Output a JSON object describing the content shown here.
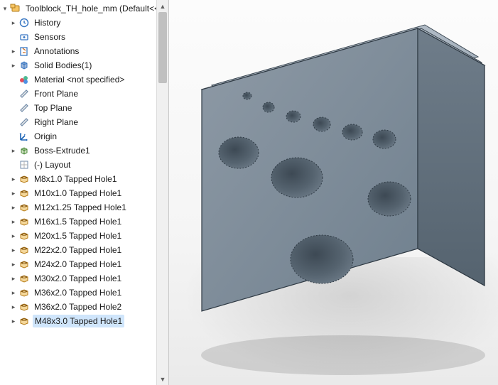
{
  "root": {
    "label": "Toolblock_TH_hole_mm  (Default<<Defa",
    "icon": "part"
  },
  "tree": [
    {
      "label": "History",
      "icon": "history",
      "expand": "▸",
      "depth": 1
    },
    {
      "label": "Sensors",
      "icon": "sensors",
      "expand": "",
      "depth": 1
    },
    {
      "label": "Annotations",
      "icon": "annot",
      "expand": "▸",
      "depth": 1
    },
    {
      "label": "Solid Bodies(1)",
      "icon": "solidbody",
      "expand": "▸",
      "depth": 1
    },
    {
      "label": "Material <not specified>",
      "icon": "material",
      "expand": "",
      "depth": 1
    },
    {
      "label": "Front Plane",
      "icon": "plane",
      "expand": "",
      "depth": 1
    },
    {
      "label": "Top Plane",
      "icon": "plane",
      "expand": "",
      "depth": 1
    },
    {
      "label": "Right Plane",
      "icon": "plane",
      "expand": "",
      "depth": 1
    },
    {
      "label": "Origin",
      "icon": "origin",
      "expand": "",
      "depth": 1
    },
    {
      "label": "Boss-Extrude1",
      "icon": "extrude",
      "expand": "▸",
      "depth": 1
    },
    {
      "label": "(-) Layout",
      "icon": "sketch",
      "expand": "",
      "depth": 1
    },
    {
      "label": "M8x1.0 Tapped Hole1",
      "icon": "hole",
      "expand": "▸",
      "depth": 1
    },
    {
      "label": "M10x1.0 Tapped Hole1",
      "icon": "hole",
      "expand": "▸",
      "depth": 1
    },
    {
      "label": "M12x1.25 Tapped Hole1",
      "icon": "hole",
      "expand": "▸",
      "depth": 1
    },
    {
      "label": "M16x1.5 Tapped Hole1",
      "icon": "hole",
      "expand": "▸",
      "depth": 1
    },
    {
      "label": "M20x1.5 Tapped Hole1",
      "icon": "hole",
      "expand": "▸",
      "depth": 1
    },
    {
      "label": "M22x2.0 Tapped Hole1",
      "icon": "hole",
      "expand": "▸",
      "depth": 1
    },
    {
      "label": "M24x2.0 Tapped Hole1",
      "icon": "hole",
      "expand": "▸",
      "depth": 1
    },
    {
      "label": "M30x2.0 Tapped Hole1",
      "icon": "hole",
      "expand": "▸",
      "depth": 1
    },
    {
      "label": "M36x2.0 Tapped Hole1",
      "icon": "hole",
      "expand": "▸",
      "depth": 1
    },
    {
      "label": "M36x2.0 Tapped Hole2",
      "icon": "hole",
      "expand": "▸",
      "depth": 1
    },
    {
      "label": "M48x3.0 Tapped Hole1",
      "icon": "hole",
      "expand": "▸",
      "depth": 1,
      "selected": true
    }
  ]
}
